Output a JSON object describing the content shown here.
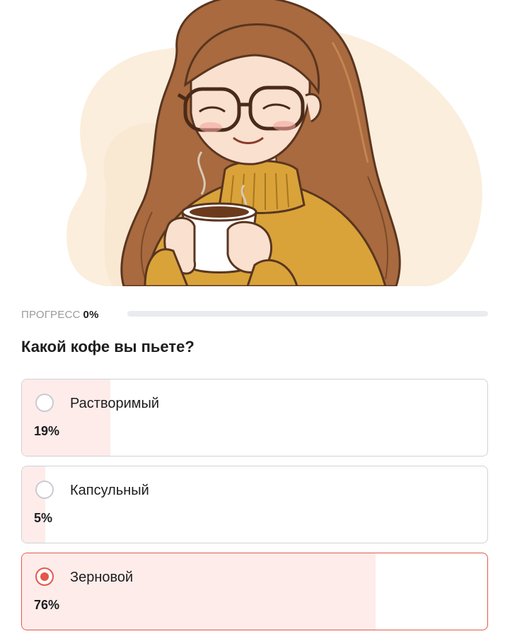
{
  "progress": {
    "label": "ПРОГРЕСС",
    "value_text": "0%",
    "value": 0
  },
  "question": {
    "text": "Какой кофе вы пьете?"
  },
  "options": [
    {
      "label": "Растворимый",
      "percent_text": "19%",
      "percent": 19,
      "selected": false
    },
    {
      "label": "Капсульный",
      "percent_text": "5%",
      "percent": 5,
      "selected": false
    },
    {
      "label": "Зерновой",
      "percent_text": "76%",
      "percent": 76,
      "selected": true
    }
  ],
  "colors": {
    "accent": "#e5574b",
    "result_fill": "#fdecea",
    "border": "#cfd2d8",
    "track": "#e9ebef",
    "muted_text": "#9a9a9e"
  },
  "icons": {
    "illustration": "woman-with-coffee-cup-illustration",
    "radio_unselected": "radio-unselected-icon",
    "radio_selected": "radio-selected-icon"
  }
}
